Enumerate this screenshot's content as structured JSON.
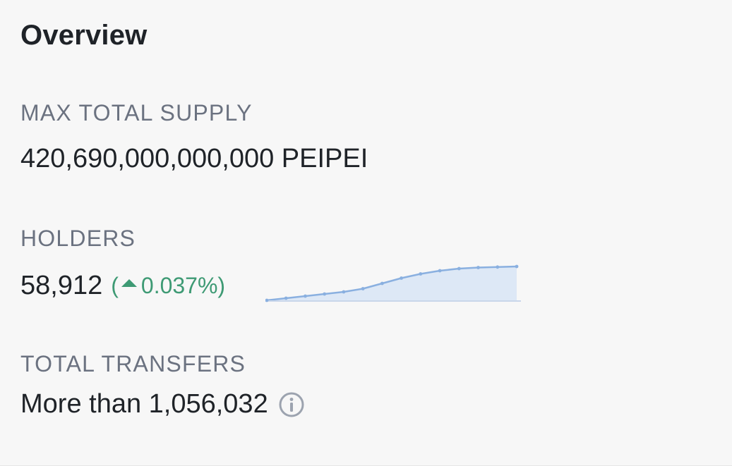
{
  "overview": {
    "title": "Overview"
  },
  "max_total_supply": {
    "label": "MAX TOTAL SUPPLY",
    "value": "420,690,000,000,000 PEIPEI"
  },
  "holders": {
    "label": "HOLDERS",
    "count": "58,912",
    "change_open": "(",
    "change_value": "0.037%)",
    "change_direction": "up",
    "change_color": "#3e9a74",
    "trend_icon": "caret-up-icon"
  },
  "holders_sparkline": {
    "line_color": "#8ab0e0",
    "fill_color": "#dde8f6",
    "values": [
      0,
      2,
      4,
      6,
      8,
      11,
      16,
      21,
      25,
      28,
      30,
      31,
      31.5,
      32
    ]
  },
  "total_transfers": {
    "label": "TOTAL TRANSFERS",
    "value": "More than 1,056,032",
    "info_icon": "info-circle-icon"
  }
}
